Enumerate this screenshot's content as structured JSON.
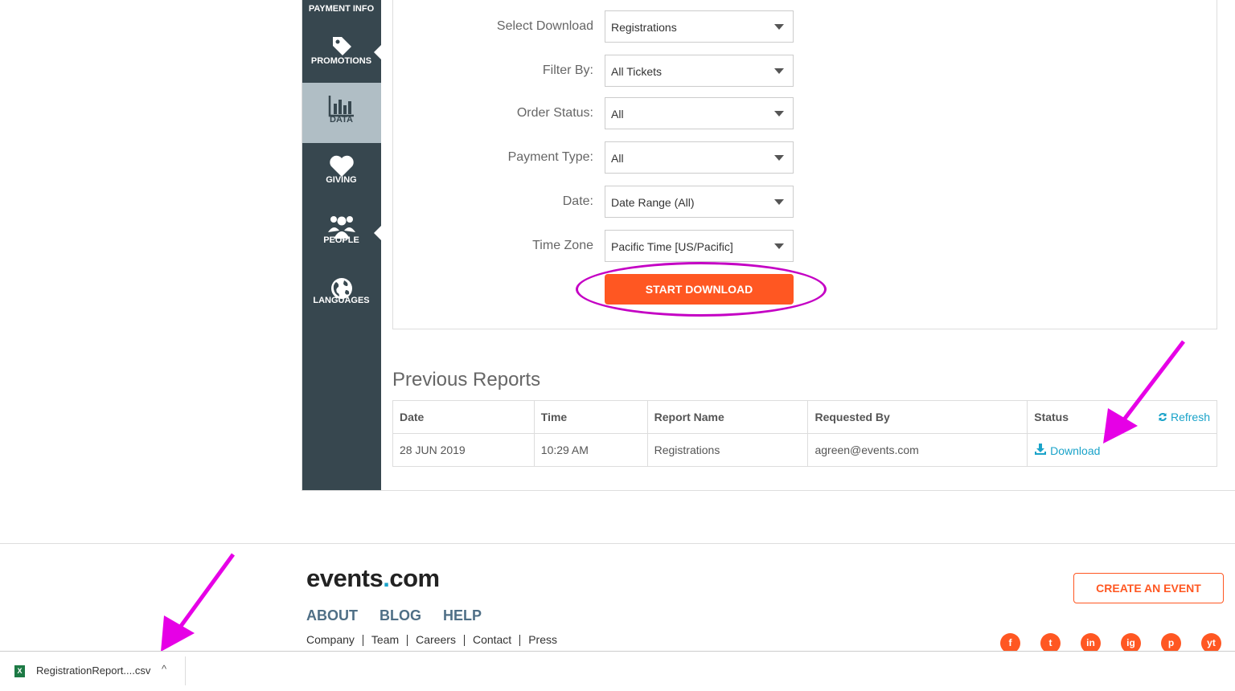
{
  "sidebar": {
    "top_label": "PAYMENT INFO",
    "items": [
      {
        "label": "PROMOTIONS",
        "icon": "tag-icon"
      },
      {
        "label": "DATA",
        "icon": "bar-chart-icon"
      },
      {
        "label": "GIVING",
        "icon": "heart-icon"
      },
      {
        "label": "PEOPLE",
        "icon": "people-icon"
      },
      {
        "label": "LANGUAGES",
        "icon": "globe-icon"
      }
    ]
  },
  "form": {
    "select_download": {
      "label": "Select Download",
      "value": "Registrations"
    },
    "filter_by": {
      "label": "Filter By:",
      "value": "All Tickets"
    },
    "order_status": {
      "label": "Order Status:",
      "value": "All"
    },
    "payment_type": {
      "label": "Payment Type:",
      "value": "All"
    },
    "date": {
      "label": "Date:",
      "value": "Date Range (All)"
    },
    "time_zone": {
      "label": "Time Zone",
      "value": "Pacific Time [US/Pacific]"
    },
    "start_button": "START DOWNLOAD"
  },
  "reports": {
    "title": "Previous Reports",
    "refresh_label": "Refresh",
    "columns": [
      "Date",
      "Time",
      "Report Name",
      "Requested By",
      "Status"
    ],
    "rows": [
      {
        "date": "28 JUN 2019",
        "time": "10:29 AM",
        "report_name": "Registrations",
        "requested_by": "agreen@events.com",
        "status": "Download"
      }
    ]
  },
  "footer": {
    "logo_main": "events",
    "logo_dot": ".",
    "logo_tld": "com",
    "nav": [
      "ABOUT",
      "BLOG",
      "HELP"
    ],
    "links": [
      "Company",
      "Team",
      "Careers",
      "Contact",
      "Press"
    ],
    "create_button": "CREATE AN EVENT",
    "social": [
      "f",
      "t",
      "in",
      "ig",
      "p",
      "yt"
    ]
  },
  "download_bar": {
    "filename": "RegistrationReport....csv",
    "file_icon_text": "X",
    "caret": "^"
  },
  "colors": {
    "accent": "#ff5722",
    "sidebar": "#37474f",
    "link": "#1aa3c9",
    "annotation": "#e600e6"
  }
}
